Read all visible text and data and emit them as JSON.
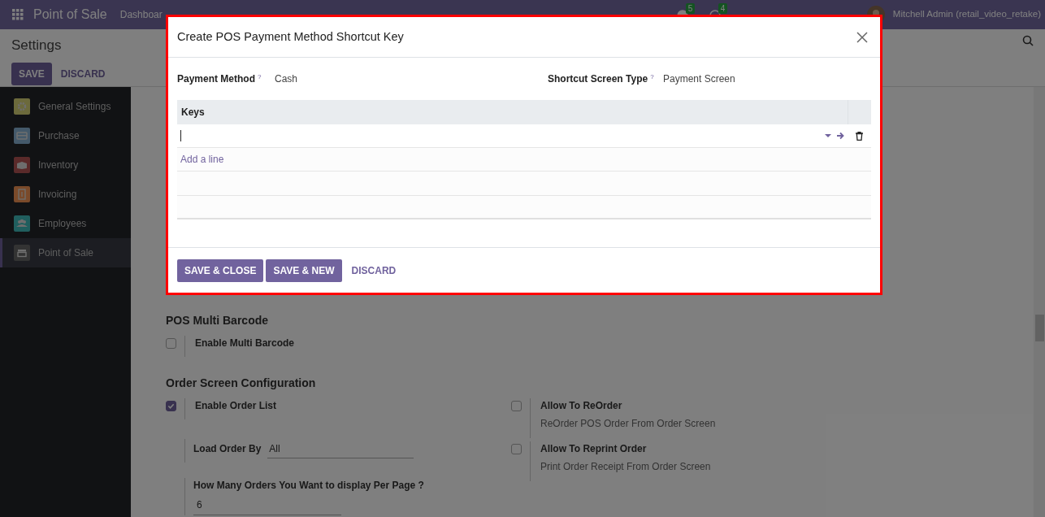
{
  "navbar": {
    "app_title": "Point of Sale",
    "menu": [
      "Dashboar"
    ],
    "badges": [
      "5",
      "4"
    ],
    "user": "Mitchell Admin (retail_video_retake)"
  },
  "control_panel": {
    "title": "Settings",
    "buttons": [
      "SAVE",
      "DISCARD"
    ]
  },
  "sidebar": {
    "items": [
      {
        "label": "General Settings",
        "color": "#6c6a3c",
        "kind": "gear",
        "selected": false
      },
      {
        "label": "Purchase",
        "color": "#44596a",
        "kind": "card",
        "selected": false
      },
      {
        "label": "Inventory",
        "color": "#5a2a2a",
        "kind": "box",
        "selected": false
      },
      {
        "label": "Invoicing",
        "color": "#7a4a2a",
        "kind": "invoice",
        "selected": false
      },
      {
        "label": "Employees",
        "color": "#205e5e",
        "kind": "people",
        "selected": false
      },
      {
        "label": "Point of Sale",
        "color": "#333333",
        "kind": "shop",
        "selected": true
      }
    ]
  },
  "settings": {
    "sections": [
      {
        "title": "POS Multi Barcode",
        "left": [
          {
            "kind": "checkbox",
            "label": "Enable Multi Barcode",
            "checked": false
          }
        ]
      },
      {
        "title": "Order Screen Configuration",
        "left": [
          {
            "kind": "checkbox",
            "label": "Enable Order List",
            "checked": true
          },
          {
            "kind": "inline_field",
            "label": "Load Order By",
            "value": "All"
          },
          {
            "kind": "stacked_field",
            "label": "How Many Orders You Want to display Per Page ?",
            "value": "6"
          }
        ],
        "right": [
          {
            "kind": "checkbox",
            "label": "Allow To ReOrder",
            "description": "ReOrder POS Order From Order Screen",
            "checked": false
          },
          {
            "kind": "checkbox",
            "label": "Allow To Reprint Order",
            "description": "Print Order Receipt From Order Screen",
            "checked": false
          }
        ]
      }
    ]
  },
  "dialog": {
    "title": "Create POS Payment Method Shortcut Key",
    "fields": [
      {
        "label": "Payment Method",
        "help": "?",
        "value": "Cash"
      },
      {
        "label": "Shortcut Screen Type",
        "help": "?",
        "value": "Payment Screen"
      }
    ],
    "table": {
      "columns": [
        "Keys"
      ],
      "add_line": "Add a line"
    },
    "buttons": [
      {
        "label": "SAVE & CLOSE",
        "kind": "primary"
      },
      {
        "label": "SAVE & NEW",
        "kind": "primary"
      },
      {
        "label": "DISCARD",
        "kind": "link"
      }
    ]
  }
}
